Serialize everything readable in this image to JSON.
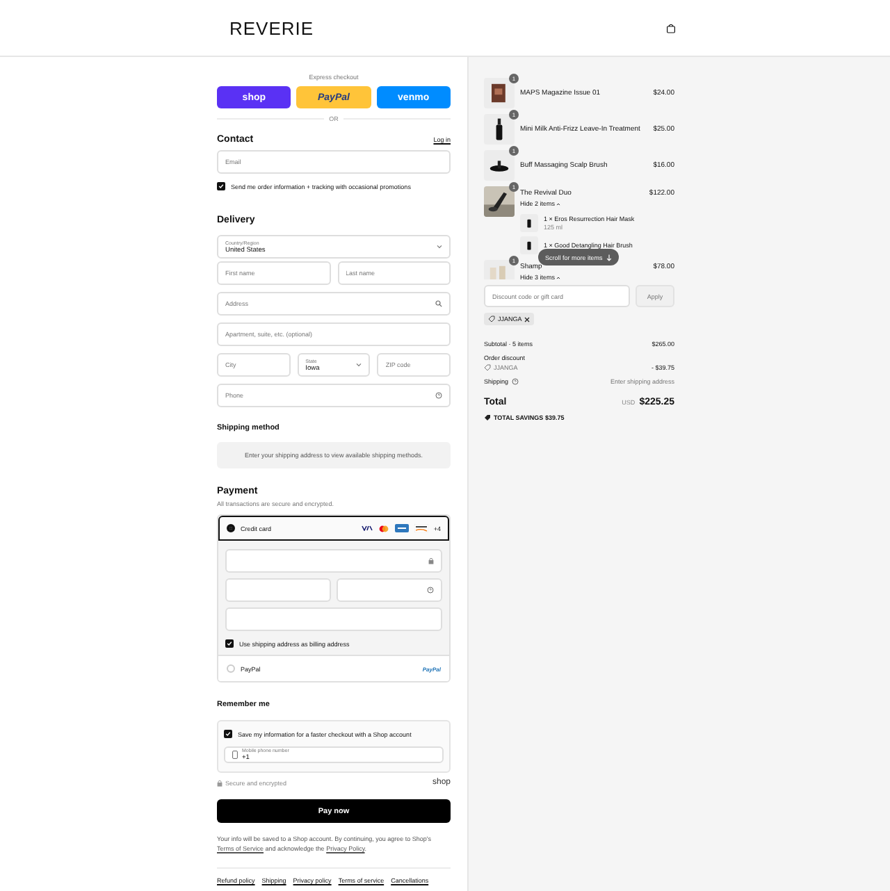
{
  "header": {
    "logo": "REVERIE"
  },
  "express": {
    "label": "Express checkout",
    "divider": "OR",
    "buttons": [
      {
        "kind": "shop",
        "label": "shop"
      },
      {
        "kind": "paypal",
        "label": "PayPal"
      },
      {
        "kind": "venmo",
        "label": "venmo"
      }
    ]
  },
  "contact": {
    "title": "Contact",
    "login": "Log in",
    "email": {
      "placeholder": "Email"
    },
    "marketing": {
      "label": "Send me order information + tracking with occasional promotions",
      "checked": true
    }
  },
  "delivery": {
    "title": "Delivery",
    "rows": [
      [
        {
          "kind": "select",
          "label": "Country/Region",
          "value": "United States"
        }
      ],
      [
        {
          "kind": "text",
          "placeholder": "First name"
        },
        {
          "kind": "text",
          "placeholder": "Last name"
        }
      ],
      [
        {
          "kind": "search",
          "placeholder": "Address"
        }
      ],
      [
        {
          "kind": "text",
          "placeholder": "Apartment, suite, etc. (optional)"
        }
      ],
      [
        {
          "kind": "text",
          "placeholder": "City"
        },
        {
          "kind": "select",
          "label": "State",
          "value": "Iowa"
        },
        {
          "kind": "text",
          "placeholder": "ZIP code"
        }
      ],
      [
        {
          "kind": "help",
          "placeholder": "Phone"
        }
      ]
    ]
  },
  "shipping": {
    "title": "Shipping method",
    "message": "Enter your shipping address to view available shipping methods."
  },
  "payment": {
    "title": "Payment",
    "subtitle": "All transactions are secure and encrypted.",
    "methods": [
      {
        "kind": "card",
        "label": "Credit card",
        "selected": true,
        "more": "+4",
        "billing": {
          "label": "Use shipping address as billing address",
          "checked": true
        }
      },
      {
        "kind": "paypal",
        "label": "PayPal",
        "selected": false,
        "logo": "PayPal"
      }
    ]
  },
  "remember": {
    "title": "Remember me",
    "save": {
      "label": "Save my information for a faster checkout with a Shop account",
      "checked": true
    },
    "phone": {
      "label": "Mobile phone number",
      "value": "+1"
    },
    "secure": "Secure and encrypted",
    "brand": "shop"
  },
  "pay_button": "Pay now",
  "legal": {
    "before": "Your info will be saved to a Shop account. By continuing, you agree to Shop's",
    "terms": "Terms of Service",
    "middle": "and acknowledge the",
    "privacy": "Privacy Policy",
    "after": "."
  },
  "footer_links": [
    "Refund policy",
    "Shipping",
    "Privacy policy",
    "Terms of service",
    "Cancellations"
  ],
  "summary": {
    "items": [
      {
        "name": "MAPS Magazine Issue 01",
        "price": "$24.00",
        "quantity": "1"
      },
      {
        "name": "Mini Milk Anti-Frizz Leave-In Treatment",
        "price": "$25.00",
        "quantity": "1"
      },
      {
        "name": "Buff Massaging Scalp Brush",
        "price": "$16.00",
        "quantity": "1"
      },
      {
        "name": "The Revival Duo",
        "price": "$122.00",
        "quantity": "1",
        "toggle": "Hide 2 items",
        "expanded": true,
        "children": [
          {
            "name": "1 × Eros Resurrection Hair Mask",
            "detail": "125 ml"
          },
          {
            "name": "1 × Good Detangling Hair Brush"
          }
        ]
      },
      {
        "name": "Shamp",
        "price": "$78.00",
        "quantity": "1",
        "toggle": "Hide 3 items",
        "expanded": true
      }
    ],
    "scroll_hint": "Scroll for more items",
    "discount": {
      "placeholder": "Discount code or gift card",
      "button": "Apply",
      "applied": "JJANGA"
    },
    "subtotal": {
      "label": "Subtotal · 5 items",
      "value": "$265.00"
    },
    "order_discount": {
      "label": "Order discount",
      "code": "JJANGA",
      "value": "- $39.75"
    },
    "shipping": {
      "label": "Shipping",
      "value": "Enter shipping address"
    },
    "total": {
      "label": "Total",
      "currency": "USD",
      "value": "$225.25"
    },
    "savings": {
      "label": "TOTAL SAVINGS",
      "value": "$39.75"
    }
  }
}
